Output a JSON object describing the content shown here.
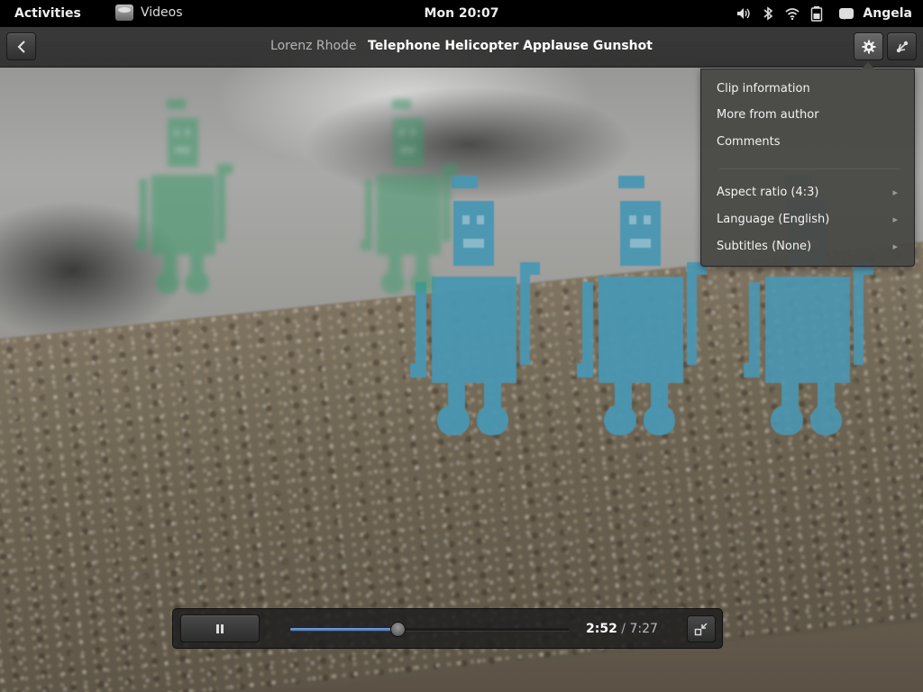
{
  "topbar": {
    "activities_label": "Activities",
    "app_name": "Videos",
    "clock": "Mon 20:07",
    "user_name": "Angela",
    "status_icons": [
      "volume-icon",
      "bluetooth-icon",
      "wifi-icon",
      "battery-icon"
    ]
  },
  "header": {
    "author": "Lorenz Rhode",
    "title": "Telephone Helicopter Applause Gunshot"
  },
  "settings_menu": {
    "items": [
      {
        "label": "Clip information",
        "submenu": false
      },
      {
        "label": "More from author",
        "submenu": false
      },
      {
        "label": "Comments",
        "submenu": false
      },
      {
        "label": "Aspect ratio (4:3)",
        "submenu": true
      },
      {
        "label": "Language (English)",
        "submenu": true
      },
      {
        "label": "Subtitles (None)",
        "submenu": true
      }
    ]
  },
  "player": {
    "current_time": "2:52",
    "separator": "/",
    "total_time": "7:27",
    "progress_fraction": 0.385
  },
  "colors": {
    "robot_blue": "#4a97b3",
    "robot_green": "#3a9a6a",
    "seek_accent": "#4a78c2"
  }
}
